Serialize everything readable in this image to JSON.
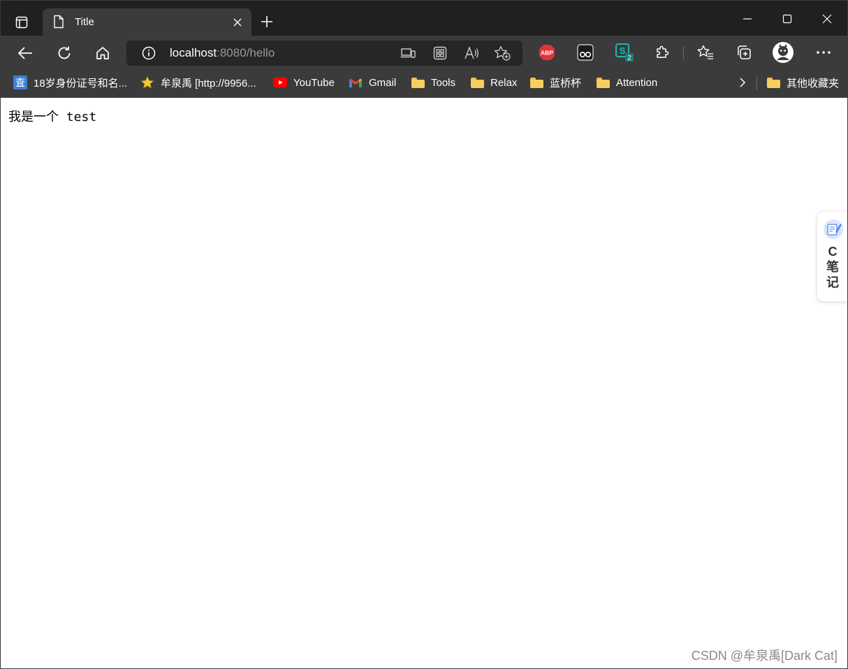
{
  "window": {
    "tab": {
      "title": "Title"
    }
  },
  "toolbar": {
    "url_host": "localhost",
    "url_rest": ":8080/hello",
    "extensions": [
      {
        "name": "ABP",
        "label": "ABP",
        "color": "#e0343c"
      },
      {
        "name": "tampermonkey",
        "label": "",
        "color": "#2b2b2b"
      },
      {
        "name": "s-extension",
        "label": "S",
        "badge": "2",
        "color": "#1fb8b0"
      }
    ]
  },
  "bookmarks": [
    {
      "label": "18岁身份证号和名...",
      "icon": "cha-icon"
    },
    {
      "label": "牟泉禹 [http://9956...",
      "icon": "star-icon"
    },
    {
      "label": "YouTube",
      "icon": "youtube-icon"
    },
    {
      "label": "Gmail",
      "icon": "gmail-icon"
    },
    {
      "label": "Tools",
      "icon": "folder-icon"
    },
    {
      "label": "Relax",
      "icon": "folder-icon"
    },
    {
      "label": "蓝桥杯",
      "icon": "folder-icon"
    },
    {
      "label": "Attention",
      "icon": "folder-icon"
    }
  ],
  "other_bookmarks": "其他收藏夹",
  "page": {
    "text": "我是一个 test"
  },
  "side_widget": {
    "line1": "C",
    "line2": "笔",
    "line3": "记"
  },
  "watermark": "CSDN @牟泉禹[Dark Cat]"
}
